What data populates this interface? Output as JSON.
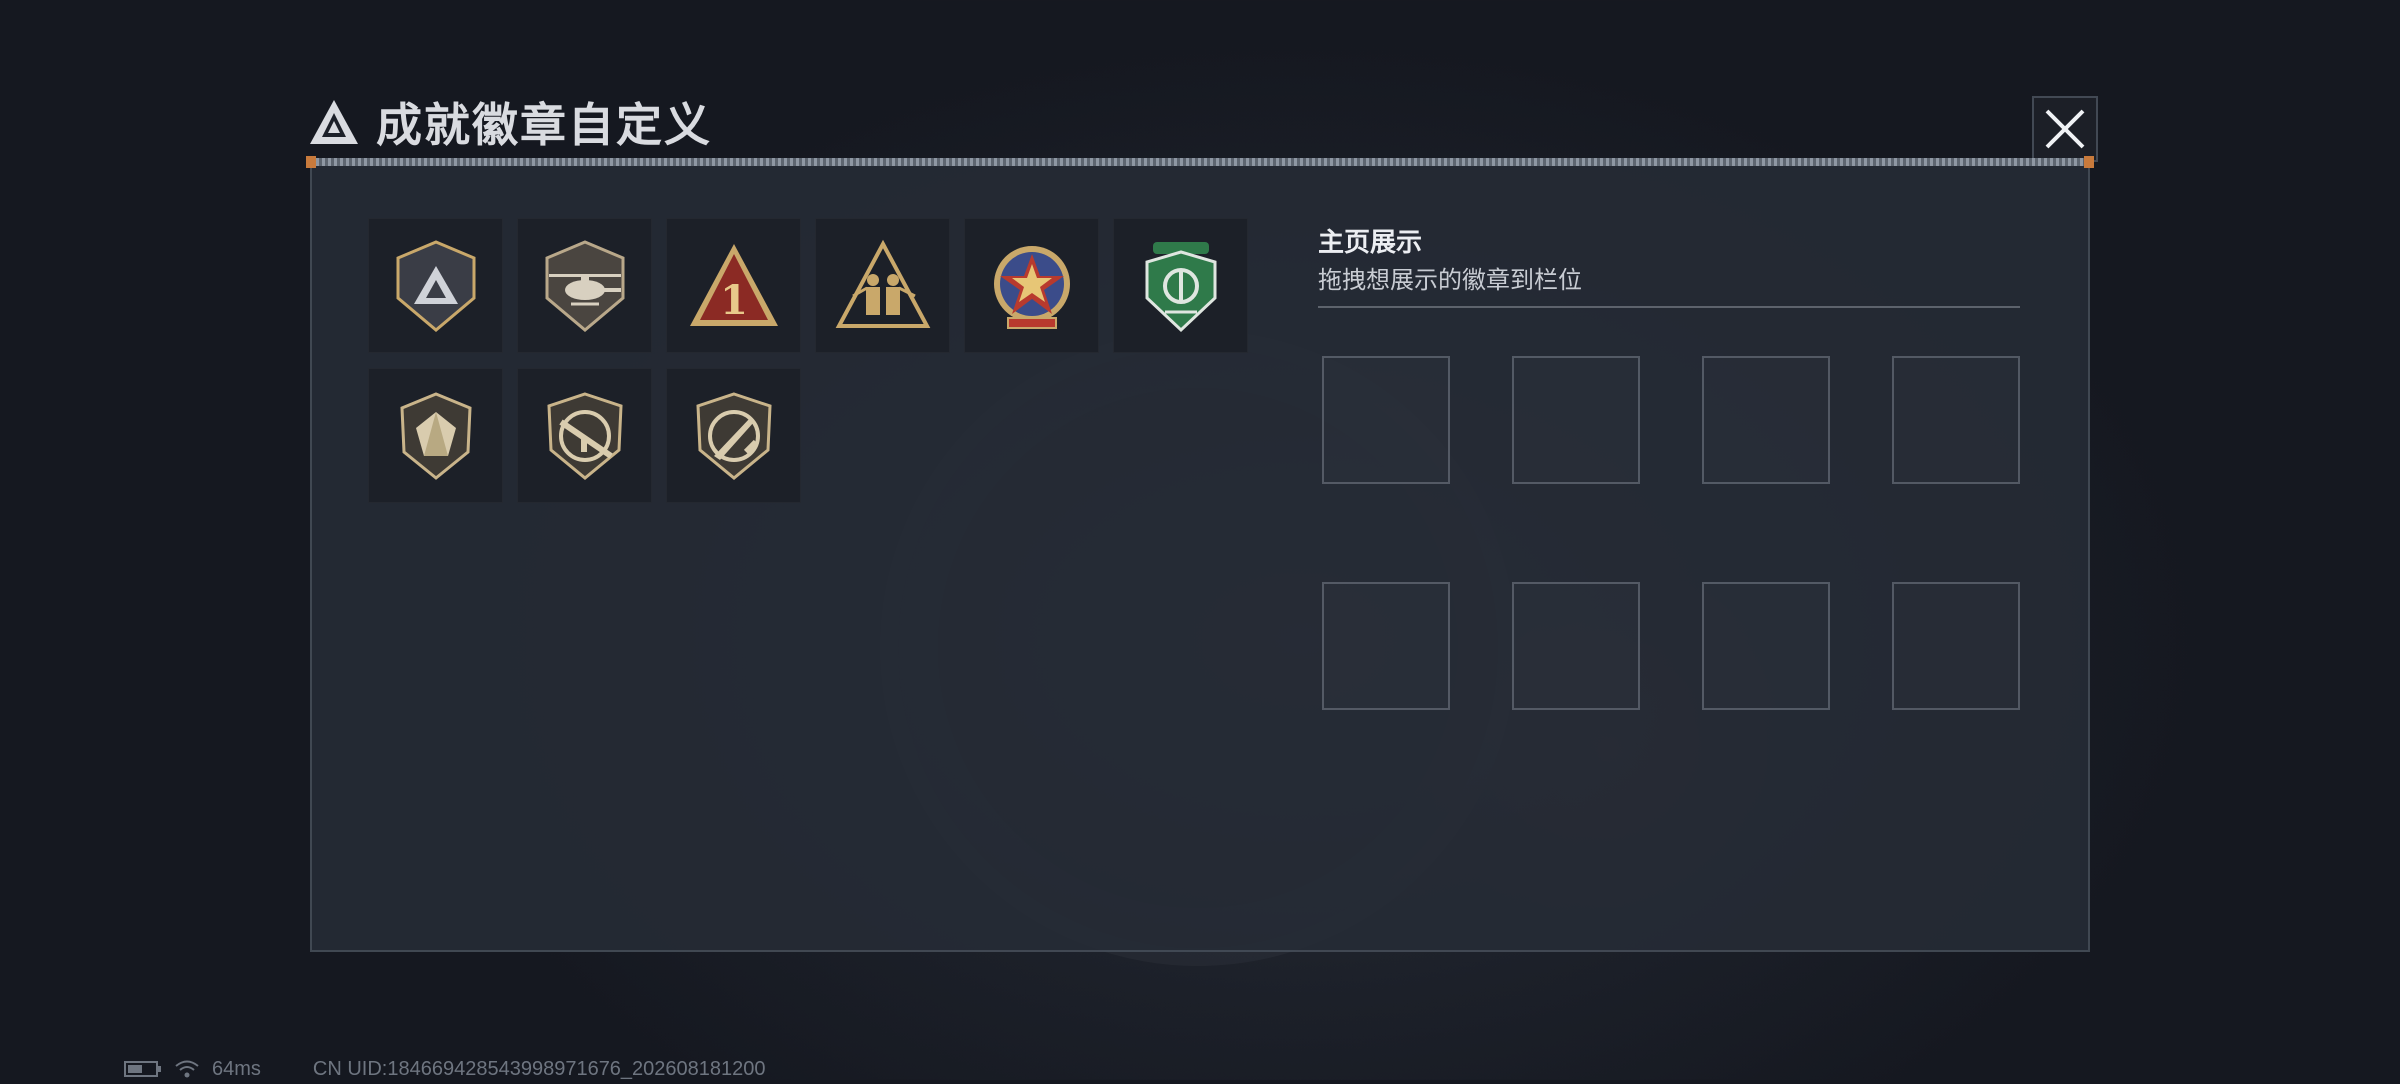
{
  "header": {
    "title": "成就徽章自定义"
  },
  "badges": [
    {
      "name": "delta-shield-badge"
    },
    {
      "name": "helicopter-badge"
    },
    {
      "name": "number-one-triangle-badge"
    },
    {
      "name": "soldiers-triangle-badge"
    },
    {
      "name": "star-medal-badge"
    },
    {
      "name": "green-shield-badge"
    },
    {
      "name": "crystal-badge"
    },
    {
      "name": "rifle-badge"
    },
    {
      "name": "knife-badge"
    }
  ],
  "showcase": {
    "title": "主页展示",
    "subtitle": "拖拽想展示的徽章到栏位",
    "slots": 8
  },
  "status": {
    "ping": "64ms",
    "uid": "CN UID:184669428543998971676_202608181200"
  },
  "colors": {
    "accent_gold": "#c9a86a",
    "accent_red": "#8b2a24",
    "accent_green": "#2f7a4a",
    "accent_orange": "#c87a3c"
  }
}
